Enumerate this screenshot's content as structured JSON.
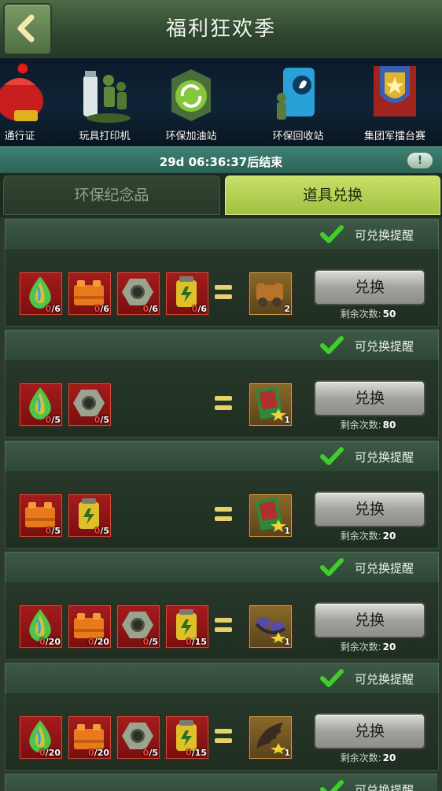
{
  "header": {
    "title": "福利狂欢季"
  },
  "icon_strip": [
    {
      "label": "通行证",
      "badge": true
    },
    {
      "label": "玩具打印机"
    },
    {
      "label": "环保加油站"
    },
    {
      "label": "环保回收站"
    },
    {
      "label": "集团军擂台赛"
    }
  ],
  "timer": {
    "text": "29d 06:36:37后结束",
    "info_label": "!"
  },
  "tabs": [
    {
      "label": "环保纪念品",
      "active": false
    },
    {
      "label": "道具兑换",
      "active": true
    }
  ],
  "exchange_cards": [
    {
      "remind_label": "可兑换提醒",
      "materials": [
        {
          "icon": "rainbow-drop-icon",
          "have": "0",
          "need": "/6"
        },
        {
          "icon": "orange-brick-icon",
          "have": "0",
          "need": "/6"
        },
        {
          "icon": "metal-nut-icon",
          "have": "0",
          "need": "/6"
        },
        {
          "icon": "yellow-battery-icon",
          "have": "0",
          "need": "/6"
        }
      ],
      "result": {
        "icon": "mech-part-icon",
        "count": "2"
      },
      "button_label": "兑换",
      "remain_label": "剩余次数:",
      "remain_value": "50"
    },
    {
      "remind_label": "可兑换提醒",
      "materials": [
        {
          "icon": "rainbow-drop-icon",
          "have": "0",
          "need": "/5"
        },
        {
          "icon": "metal-nut-icon",
          "have": "0",
          "need": "/5"
        }
      ],
      "result": {
        "icon": "card-pack-icon",
        "count": "1"
      },
      "button_label": "兑换",
      "remain_label": "剩余次数:",
      "remain_value": "80"
    },
    {
      "remind_label": "可兑换提醒",
      "materials": [
        {
          "icon": "orange-brick-icon",
          "have": "0",
          "need": "/5"
        },
        {
          "icon": "yellow-battery-icon",
          "have": "0",
          "need": "/5"
        }
      ],
      "result": {
        "icon": "card-pack-icon",
        "count": "1"
      },
      "button_label": "兑换",
      "remain_label": "剩余次数:",
      "remain_value": "20"
    },
    {
      "remind_label": "可兑换提醒",
      "materials": [
        {
          "icon": "rainbow-drop-icon",
          "have": "0",
          "need": "/20"
        },
        {
          "icon": "orange-brick-icon",
          "have": "0",
          "need": "/20"
        },
        {
          "icon": "metal-nut-icon",
          "have": "0",
          "need": "/5"
        },
        {
          "icon": "yellow-battery-icon",
          "have": "0",
          "need": "/15"
        }
      ],
      "result": {
        "icon": "goggles-icon",
        "count": "1"
      },
      "button_label": "兑换",
      "remain_label": "剩余次数:",
      "remain_value": "20"
    },
    {
      "remind_label": "可兑换提醒",
      "materials": [
        {
          "icon": "rainbow-drop-icon",
          "have": "0",
          "need": "/20"
        },
        {
          "icon": "orange-brick-icon",
          "have": "0",
          "need": "/20"
        },
        {
          "icon": "metal-nut-icon",
          "have": "0",
          "need": "/5"
        },
        {
          "icon": "yellow-battery-icon",
          "have": "0",
          "need": "/15"
        }
      ],
      "result": {
        "icon": "wing-icon",
        "count": "1"
      },
      "button_label": "兑换",
      "remain_label": "剩余次数:",
      "remain_value": "20"
    },
    {
      "remind_label": "可兑换提醒"
    }
  ]
}
